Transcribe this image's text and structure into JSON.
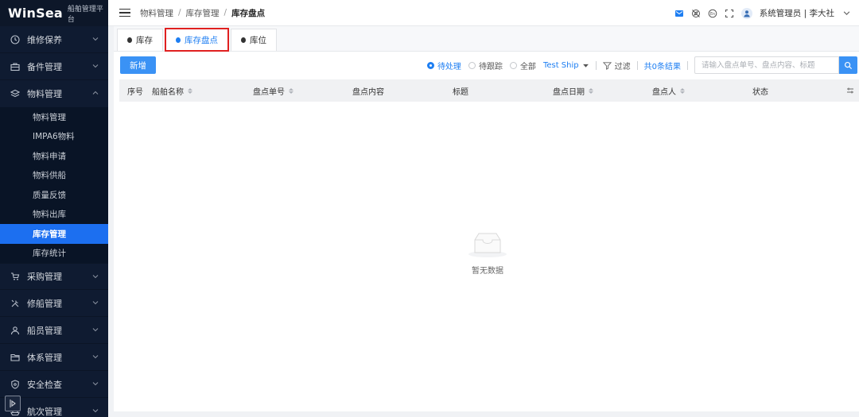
{
  "brand": {
    "logo": "WinSea",
    "subtitle": "船舶管理平台"
  },
  "sidebar": {
    "groups_top": [
      {
        "label": "维修保养",
        "icon": "clock-icon"
      },
      {
        "label": "备件管理",
        "icon": "briefcase-icon"
      },
      {
        "label": "物料管理",
        "icon": "layers-icon"
      }
    ],
    "sub_items": [
      {
        "label": "物料管理",
        "active": false
      },
      {
        "label": "IMPA6物料",
        "active": false
      },
      {
        "label": "物料申请",
        "active": false
      },
      {
        "label": "物料供船",
        "active": false
      },
      {
        "label": "质量反馈",
        "active": false
      },
      {
        "label": "物料出库",
        "active": false
      },
      {
        "label": "库存管理",
        "active": true
      },
      {
        "label": "库存统计",
        "active": false
      }
    ],
    "groups_bottom": [
      {
        "label": "采购管理",
        "icon": "cart-icon"
      },
      {
        "label": "修船管理",
        "icon": "tools-icon"
      },
      {
        "label": "船员管理",
        "icon": "user-icon"
      },
      {
        "label": "体系管理",
        "icon": "folder-icon"
      },
      {
        "label": "安全检查",
        "icon": "shield-icon"
      },
      {
        "label": "航次管理",
        "icon": "ship-icon"
      }
    ]
  },
  "header": {
    "breadcrumb": [
      "物料管理",
      "库存管理",
      "库存盘点"
    ],
    "user": "系统管理员 | 李大社"
  },
  "tabs": [
    {
      "label": "库存",
      "active": false
    },
    {
      "label": "库存盘点",
      "active": true
    },
    {
      "label": "库位",
      "active": false
    }
  ],
  "toolbar": {
    "add_label": "新增",
    "radios": [
      {
        "label": "待处理",
        "checked": true
      },
      {
        "label": "待跟踪",
        "checked": false
      },
      {
        "label": "全部",
        "checked": false
      }
    ],
    "ship": "Test Ship",
    "filter_label": "过滤",
    "result_count": "共0条结果",
    "search_placeholder": "请输入盘点单号、盘点内容、标题"
  },
  "table": {
    "columns": [
      {
        "label": "序号",
        "sortable": false
      },
      {
        "label": "船舶名称",
        "sortable": true
      },
      {
        "label": "盘点单号",
        "sortable": true
      },
      {
        "label": "盘点内容",
        "sortable": false
      },
      {
        "label": "标题",
        "sortable": false
      },
      {
        "label": "盘点日期",
        "sortable": true
      },
      {
        "label": "盘点人",
        "sortable": true
      },
      {
        "label": "状态",
        "sortable": false
      }
    ],
    "empty_text": "暂无数据"
  },
  "colors": {
    "primary": "#1d7ef2",
    "sidebar_bg": "#0f1b31",
    "active_item": "#1c6ff0",
    "highlight": "#e02020"
  }
}
